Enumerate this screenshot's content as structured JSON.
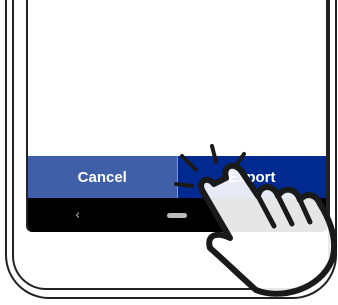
{
  "dialog": {
    "cancel_label": "Cancel",
    "export_label": "Export"
  },
  "navigation": {
    "back_glyph": "‹"
  },
  "colors": {
    "cancel_bg": "#3f5fa8",
    "export_bg": "#002a8f",
    "nav_bg": "#000000"
  },
  "icons": {
    "pointer": "tap-hand-icon",
    "back": "back-icon",
    "home": "home-pill-icon"
  }
}
